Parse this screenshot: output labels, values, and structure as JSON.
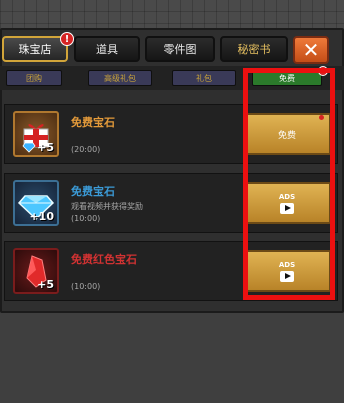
{
  "tabs": [
    {
      "label": "珠宝店",
      "active": true,
      "badge": "!"
    },
    {
      "label": "道具",
      "active": false
    },
    {
      "label": "零件图",
      "active": false
    },
    {
      "label": "秘密书",
      "active": false
    }
  ],
  "close_icon": "close-icon",
  "subtabs": [
    {
      "label": "团购",
      "active": false
    },
    {
      "label": "高级礼包",
      "active": false
    },
    {
      "label": "礼包",
      "active": false
    },
    {
      "label": "免费",
      "active": true
    }
  ],
  "colors": {
    "title_orange": "#e39a3a",
    "title_blue": "#3b9ad6",
    "title_red": "#d23232",
    "button_gold": "#c99535",
    "highlight_red": "#ec1010"
  },
  "items": [
    {
      "icon": "gift-gem-icon",
      "quantity": "+5",
      "title": "免费宝石",
      "description": "",
      "timer": "(20:00)",
      "action_label": "免费",
      "ads": ""
    },
    {
      "icon": "diamond-icon",
      "quantity": "+10",
      "title": "免费宝石",
      "description": "观看视频并获得奖励",
      "timer": "(10:00)",
      "action_label": "",
      "ads": "ADS"
    },
    {
      "icon": "red-gem-icon",
      "quantity": "+5",
      "title": "免费红色宝石",
      "description": "",
      "timer": "(10:00)",
      "action_label": "",
      "ads": "ADS"
    }
  ]
}
